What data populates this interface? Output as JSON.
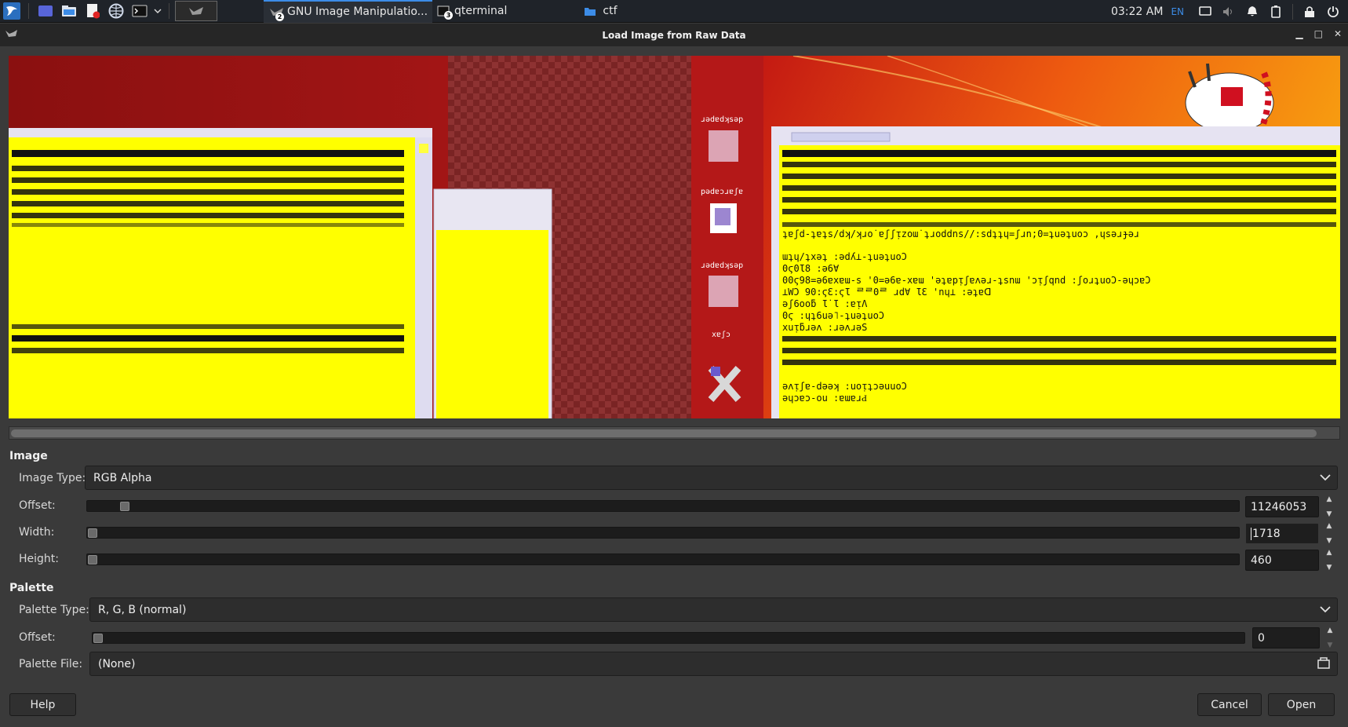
{
  "taskbar": {
    "tasks": [
      {
        "label": "GNU Image Manipulatio...",
        "badge": "2"
      },
      {
        "label": "qterminal",
        "badge": "3"
      },
      {
        "label": "ctf"
      }
    ],
    "clock": "03:22 AM",
    "language": "EN"
  },
  "dialog": {
    "title": "Load Image from Raw Data"
  },
  "image_section": {
    "heading": "Image",
    "image_type_label": "Image Type:",
    "image_type_value": "RGB Alpha",
    "offset_label": "Offset:",
    "offset_value": "11246053",
    "width_label": "Width:",
    "width_value": "1718",
    "height_label": "Height:",
    "height_value": "460"
  },
  "palette_section": {
    "heading": "Palette",
    "palette_type_label": "Palette Type:",
    "palette_type_value": "R, G, B (normal)",
    "offset_label": "Offset:",
    "offset_value": "0",
    "file_label": "Palette File:",
    "file_value": "(None)"
  },
  "buttons": {
    "help": "Help",
    "cancel": "Cancel",
    "open": "Open"
  },
  "preview": {
    "desktop_icons": [
      {
        "label": "ɹǝdɐdʞsǝp"
      },
      {
        "label": "pǝdɐɔɹɐʃɐ"
      },
      {
        "label": "ɹǝdɐdʞsǝp"
      },
      {
        "label": "xɐʃɔ"
      }
    ],
    "garbled_lines_right": [
      "ɯʇɥ/ʇxǝʇ :ǝdʎ⊥-ʇuǝʇuoƆ",
      "0ϛ0Ɩ8 :ǝ6∀",
      "00ϛ98=ǝ6ɐxɐɯ-s '0=ǝ6ɐ-xɐɯ 'ǝʇɐpᴉʃɐʌǝɹ-ʇsnɯ 'ɔᴉʃqnd :ʃoɹʇuoƆ-ǝɥɔɐƆ",
      "⊥WƆ 90:ϛƐ:ϛƖ ᄅᄅ0ᄅ ɹd∀ ƖƐ 'nɥ⊥ :ǝʇɐᗡ",
      "ǝʃ6ooƃ Ɩ˙Ɩ :ɐᴉΛ",
      "0ϛ :ɥʇ6uǝ˥-ʇuǝʇuoƆ",
      "xuᴉƃɹǝʌ :ɹǝʌɹǝS",
      "ǝʌᴉʃɐ-dǝǝʞ :uoᴉʇɔǝuuoƆ",
      "ǝɥɔɐɔ-ou :ɐɯɐɹԀ"
    ],
    "garbled_line_url": "ʇɐʃd-ʇɐʇs/dʞ/ʞɹo˙ɐʃʃᴉzoɯ˙ʇɹoddns//:sdʇʇɥ=ʃɹn;0=ʇuǝʇuoɔ ,ɥsǝɹɟǝɹ"
  }
}
